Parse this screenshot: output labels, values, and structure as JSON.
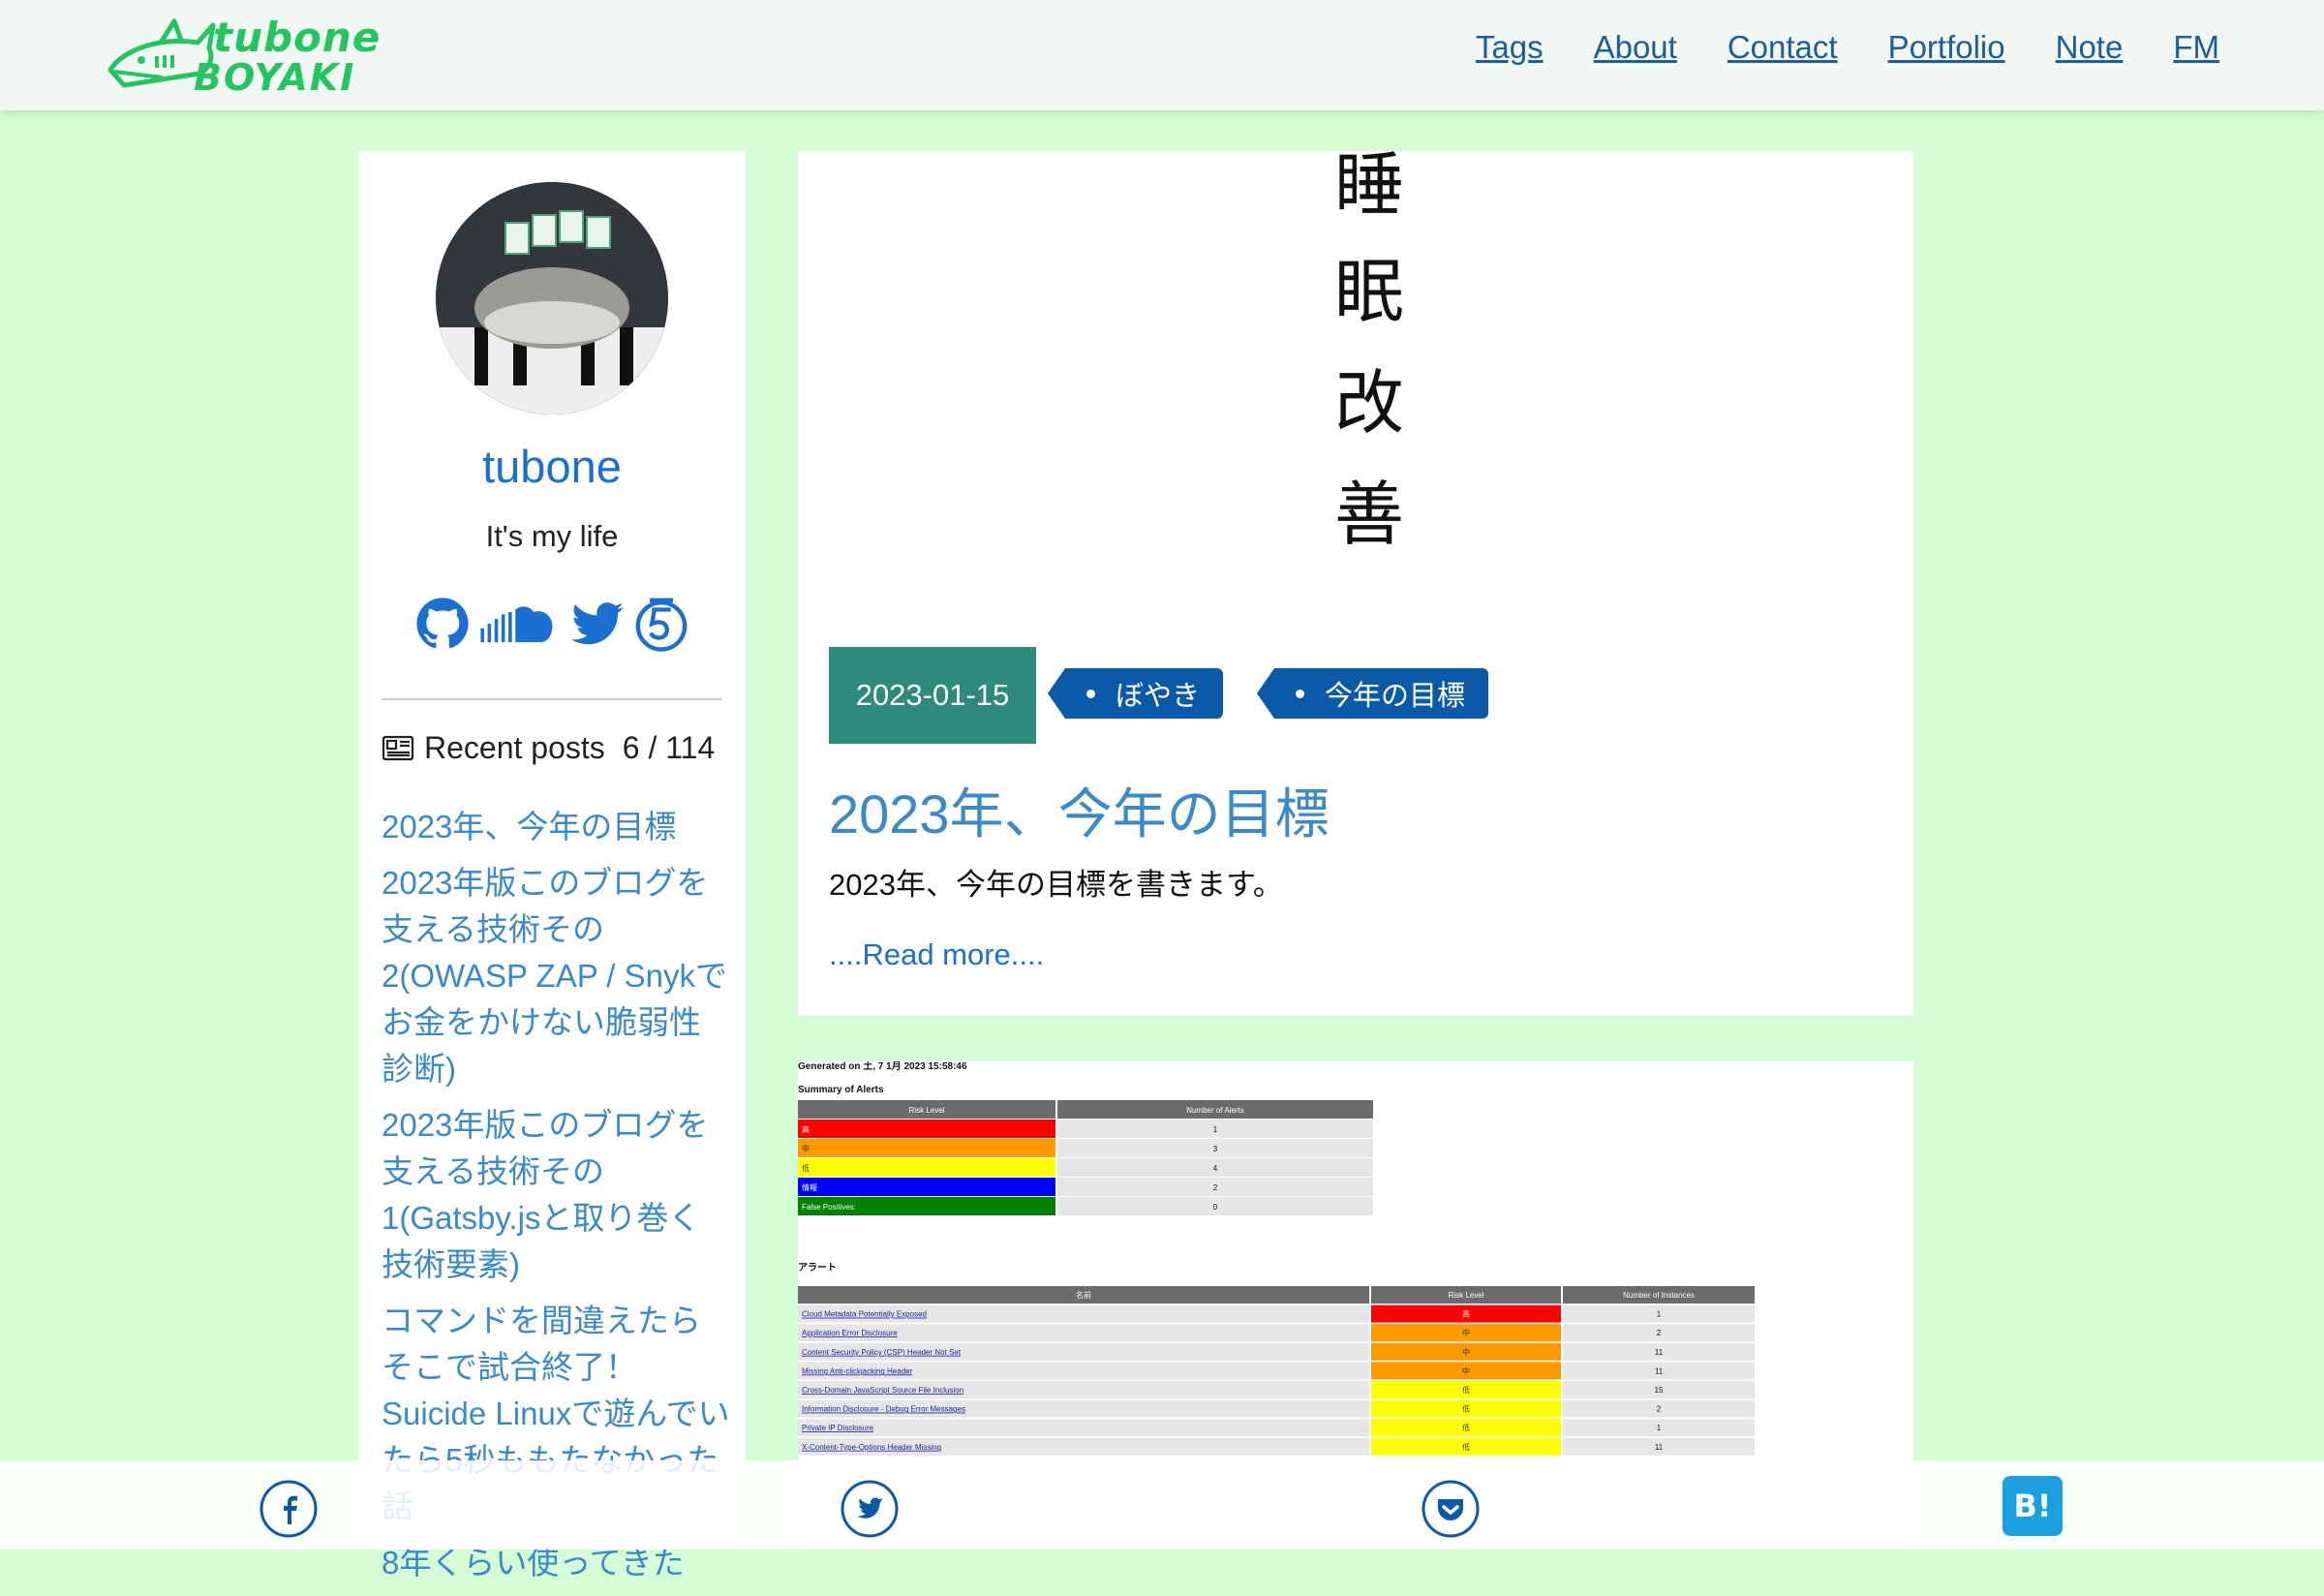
{
  "header": {
    "logo_line1": "tubone",
    "logo_line2": "BOYAKI",
    "nav": [
      "Tags",
      "About",
      "Contact",
      "Portfolio",
      "Note",
      "FM"
    ]
  },
  "sidebar": {
    "author": "tubone",
    "tagline": "It's my life",
    "social_icons": [
      "github-icon",
      "soundcloud-icon",
      "twitter-icon",
      "5-badge-icon"
    ],
    "recent_label": "Recent posts",
    "recent_count": "6 / 114",
    "recent_posts": [
      "2023年、今年の目標",
      "2023年版このブログを支える技術その2(OWASP ZAP / Snykでお金をかけない脆弱性診断)",
      "2023年版このブログを支える技術その1(Gatsby.jsと取り巻く技術要素)",
      "コマンドを間違えたらそこで試合終了！ Suicide Linuxで遊んでいたら5秒ももたなかった話",
      "8年くらい使ってきた"
    ]
  },
  "post1": {
    "hero_text": "睡眠改善",
    "date": "2023-01-15",
    "tags": [
      "ぼやき",
      "今年の目標"
    ],
    "title": "2023年、今年の目標",
    "excerpt": "2023年、今年の目標を書きます。",
    "read_more": "....Read more...."
  },
  "post2": {
    "report_generated": "Generated on 土, 7 1月 2023 15:58:46",
    "summary_heading": "Summary of Alerts",
    "summary_columns": [
      "Risk Level",
      "Number of Alerts"
    ],
    "summary_rows": [
      {
        "level": "高",
        "count": "1",
        "color": "#ff0000"
      },
      {
        "level": "中",
        "count": "3",
        "color": "#ff9900"
      },
      {
        "level": "低",
        "count": "4",
        "color": "#ffff00"
      },
      {
        "level": "情報",
        "count": "2",
        "color": "#0000ff"
      },
      {
        "level": "False Positives:",
        "count": "0",
        "color": "#008000"
      }
    ],
    "alerts_heading": "アラート",
    "alerts_columns": [
      "名前",
      "Risk Level",
      "Number of Instances"
    ],
    "alerts_rows": [
      {
        "name": "Cloud Metadata Potentially Exposed",
        "risk": "高",
        "count": "1",
        "color": "#ff0000"
      },
      {
        "name": "Application Error Disclosure",
        "risk": "中",
        "count": "2",
        "color": "#ff9900"
      },
      {
        "name": "Content Security Policy (CSP) Header Not Set",
        "risk": "中",
        "count": "11",
        "color": "#ff9900"
      },
      {
        "name": "Missing Anti-clickjacking Header",
        "risk": "中",
        "count": "11",
        "color": "#ff9900"
      },
      {
        "name": "Cross-Domain JavaScript Source File Inclusion",
        "risk": "低",
        "count": "15",
        "color": "#ffff00"
      },
      {
        "name": "Information Disclosure - Debug Error Messages",
        "risk": "低",
        "count": "2",
        "color": "#ffff00"
      },
      {
        "name": "Private IP Disclosure",
        "risk": "低",
        "count": "1",
        "color": "#ffff00"
      },
      {
        "name": "X-Content-Type-Options Header Missing",
        "risk": "低",
        "count": "11",
        "color": "#ffff00"
      }
    ]
  },
  "share": [
    "facebook-icon",
    "twitter-icon",
    "pocket-icon",
    "hatena-bookmark-icon"
  ],
  "share_hatena_label": "B!",
  "colors": {
    "page_bg": "#d4fdd6",
    "accent_green": "#22c55e",
    "link_blue": "#3a8ac7",
    "date_badge": "#2e8b7c",
    "tag_blue": "#0b5aa8"
  }
}
